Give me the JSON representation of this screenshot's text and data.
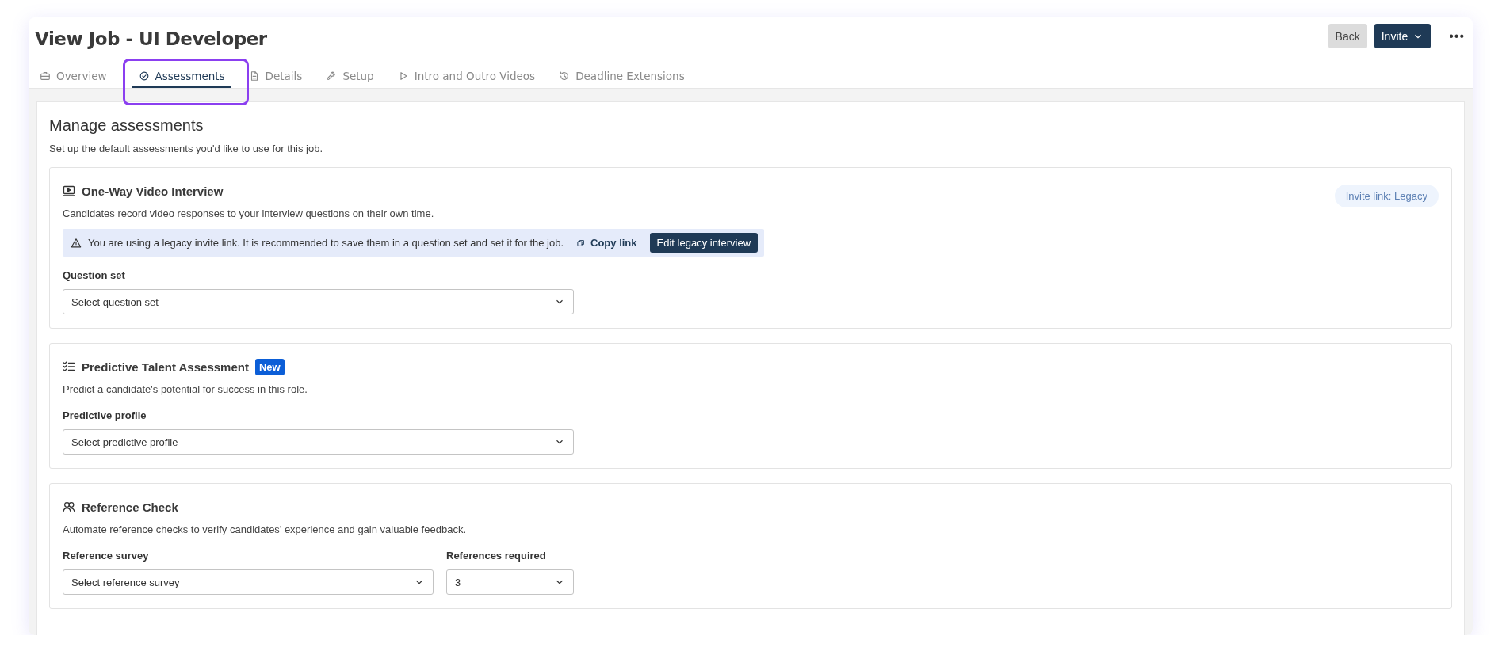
{
  "header": {
    "title": "View Job - UI Developer",
    "buttons": [
      {
        "label": "Back",
        "kind": "secondary"
      },
      {
        "label": "Invite",
        "kind": "primary"
      }
    ],
    "more_menu": "•••"
  },
  "tabs": [
    {
      "label": "Overview",
      "selected": false
    },
    {
      "label": "Assessments",
      "selected": true
    },
    {
      "label": "Details",
      "selected": false
    },
    {
      "label": "Setup",
      "selected": false
    },
    {
      "label": "Intro and Outro Videos",
      "selected": false
    },
    {
      "label": "Deadline Extensions",
      "selected": false
    }
  ],
  "page": {
    "heading": "Manage assessments",
    "subtitle": "Set up the default assessments you'd like to use for this job."
  },
  "sections": [
    {
      "kind": "video",
      "title": "One-Way Video Interview",
      "description": "Candidates record video responses to your interview questions on their own time.",
      "status_pill": "Invite link: Legacy",
      "alert": {
        "message": "You are using a legacy invite link. It is recommended to save them in a question set and set it for the job.",
        "link": "Copy link",
        "button": "Edit legacy interview"
      },
      "fields": [
        {
          "label": "Question set",
          "placeholder": "Select question set"
        }
      ]
    },
    {
      "kind": "predictive",
      "title": "Predictive Talent Assessment",
      "badge": "New",
      "description": "Predict a candidate's potential for success in this role.",
      "fields": [
        {
          "label": "Predictive profile",
          "placeholder": "Select predictive profile"
        }
      ]
    },
    {
      "kind": "reference",
      "title": "Reference Check",
      "description": "Automate reference checks to verify candidates’ experience and gain valuable feedback.",
      "fields": [
        {
          "label": "Reference survey",
          "placeholder": "Select reference survey"
        },
        {
          "label": "References required",
          "value": "3"
        }
      ]
    }
  ]
}
